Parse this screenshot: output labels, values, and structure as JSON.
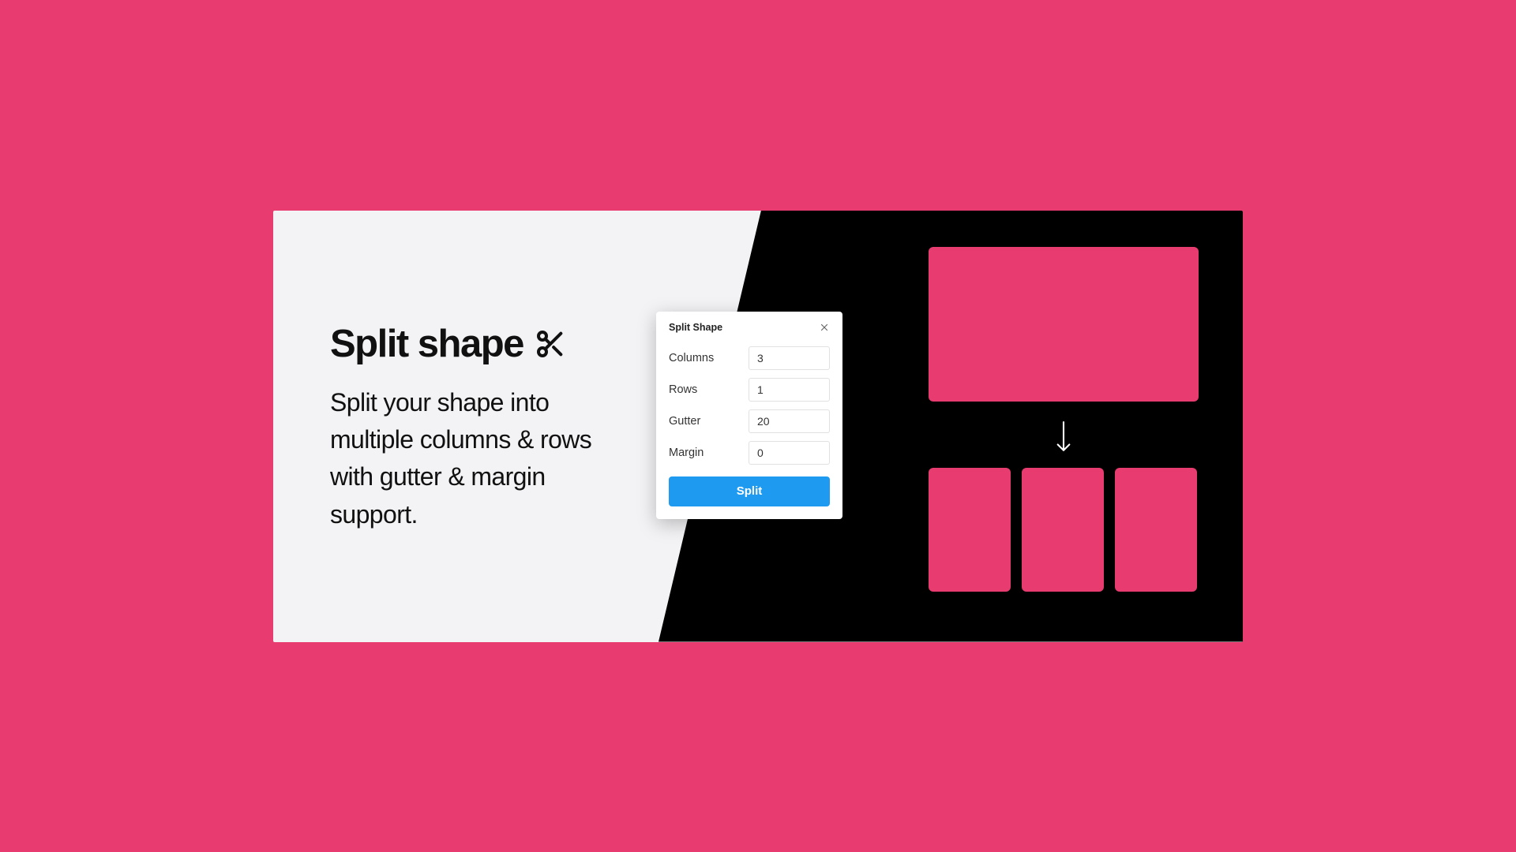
{
  "hero": {
    "title": "Split shape",
    "description": "Split your shape into multiple columns & rows with gutter & margin support."
  },
  "dialog": {
    "title": "Split Shape",
    "fields": {
      "columns": {
        "label": "Columns",
        "value": "3"
      },
      "rows": {
        "label": "Rows",
        "value": "1"
      },
      "gutter": {
        "label": "Gutter",
        "value": "20"
      },
      "margin": {
        "label": "Margin",
        "value": "0"
      }
    },
    "button": "Split"
  },
  "icons": {
    "scissors": "scissors-icon",
    "close": "close-icon",
    "arrow_down": "arrow-down-icon"
  },
  "colors": {
    "background": "#e83b6f",
    "accent": "#1e9bf0"
  }
}
